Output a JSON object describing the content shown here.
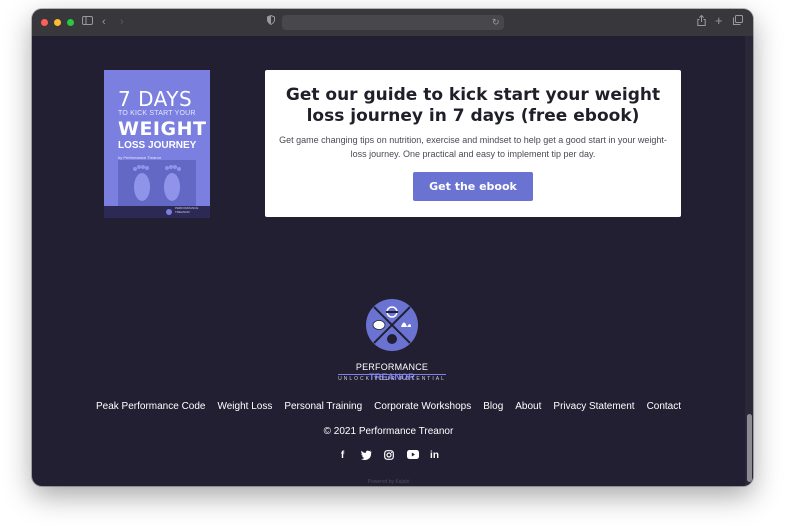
{
  "browser": {
    "url": "",
    "colors": {
      "close": "#ff5f57",
      "minimize": "#febc2e",
      "maximize": "#28c840"
    }
  },
  "ebook_cover": {
    "title_line1": "7 DAYS",
    "subtitle": "TO KICK START YOUR",
    "title_line2": "WEIGHT",
    "title_line3": "LOSS JOURNEY",
    "author": "by Performance Treanor",
    "footer_brand": "PERFORMANCE TREANOR"
  },
  "cta": {
    "heading": "Get our guide to kick start your weight loss journey in 7 days (free ebook)",
    "text": "Get game changing tips on nutrition, exercise and mindset to help get a good start in your weight-loss journey. One practical and easy to implement tip per day.",
    "button_label": "Get the ebook"
  },
  "brand": {
    "name_part1": "PERFORMANCE ",
    "name_part2": "TREANOR",
    "tagline": "UNLOCK  YOUR  POTENTIAL",
    "accent_color": "#6a73d2"
  },
  "footer": {
    "nav": [
      "Peak Performance Code",
      "Weight Loss",
      "Personal Training",
      "Corporate Workshops",
      "Blog",
      "About",
      "Privacy Statement",
      "Contact"
    ],
    "copyright": "© 2021 Performance Treanor",
    "socials": [
      "facebook-icon",
      "twitter-icon",
      "instagram-icon",
      "youtube-icon",
      "linkedin-icon"
    ],
    "powered_by": "Powered by Kajabi"
  }
}
